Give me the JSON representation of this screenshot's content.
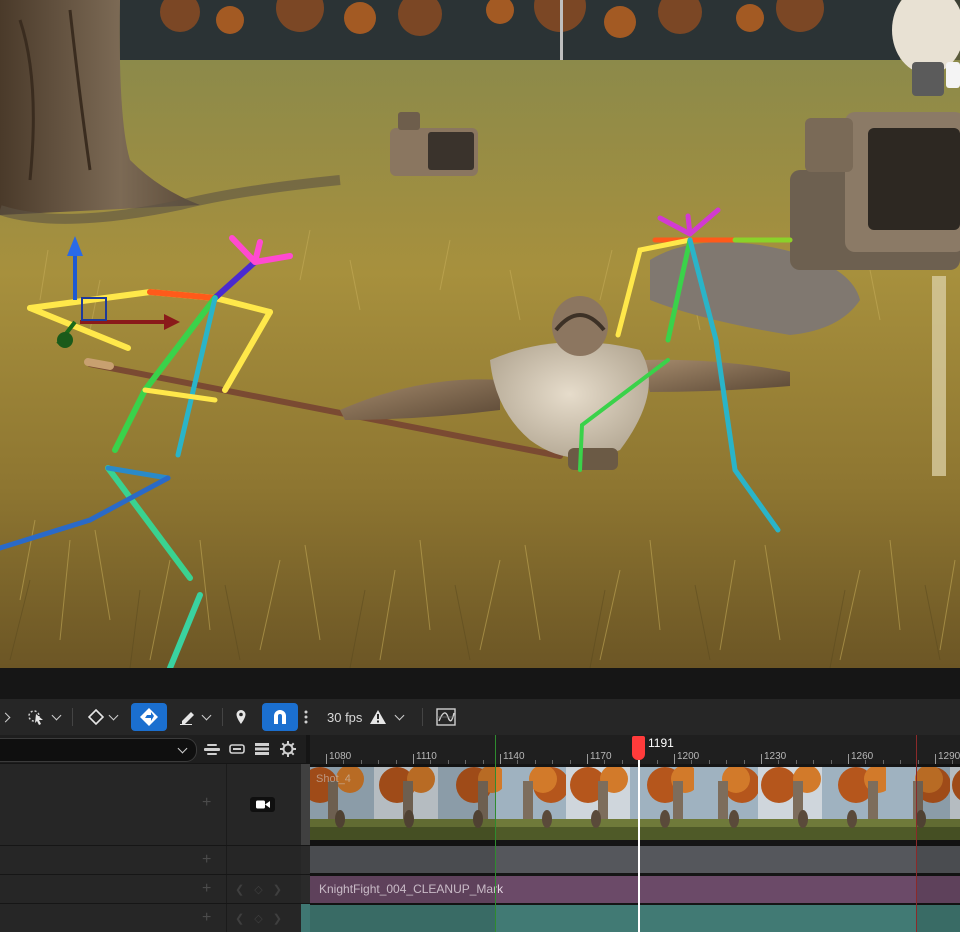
{
  "toolbar": {
    "items": [
      {
        "name": "transform-tools",
        "icon": "arrow-left-icon"
      },
      {
        "name": "select-mode",
        "icon": "select-keys-icon"
      },
      {
        "name": "key-type",
        "icon": "diamond-key-icon"
      },
      {
        "name": "auto-key",
        "icon": "auto-key-icon",
        "active": true
      },
      {
        "name": "edit-tool",
        "icon": "pen-icon"
      },
      {
        "name": "marker",
        "icon": "marker-pin-icon"
      },
      {
        "name": "snap",
        "icon": "magnet-icon",
        "active": true
      },
      {
        "name": "more",
        "icon": "kebab-icon"
      },
      {
        "name": "curve-editor",
        "icon": "curve-editor-icon"
      }
    ],
    "fps_label": "30 fps",
    "fps_warning_icon": "warning-icon"
  },
  "header": {
    "search_placeholder": "",
    "icons": [
      "collapse-all-icon",
      "expand-icon",
      "list-icon",
      "gear-icon"
    ]
  },
  "ruler": {
    "ticks": [
      "1080",
      "1110",
      "1140",
      "1170",
      "1200",
      "1230",
      "1260",
      "1290"
    ],
    "playhead_frame": "1191",
    "playhead_color": "#ff3b3b",
    "range_start_color": "#2f8b2f",
    "range_end_color": "#8b2a2a"
  },
  "tracks": {
    "camera_track_label": "Shot_4",
    "camera_icon": "camera-icon",
    "animation_track_label": "KnightFight_004_CLEANUP_Mark",
    "lane_colors": {
      "gray": "#55575c",
      "purple": "#6b4a68",
      "teal": "#417a74"
    }
  }
}
